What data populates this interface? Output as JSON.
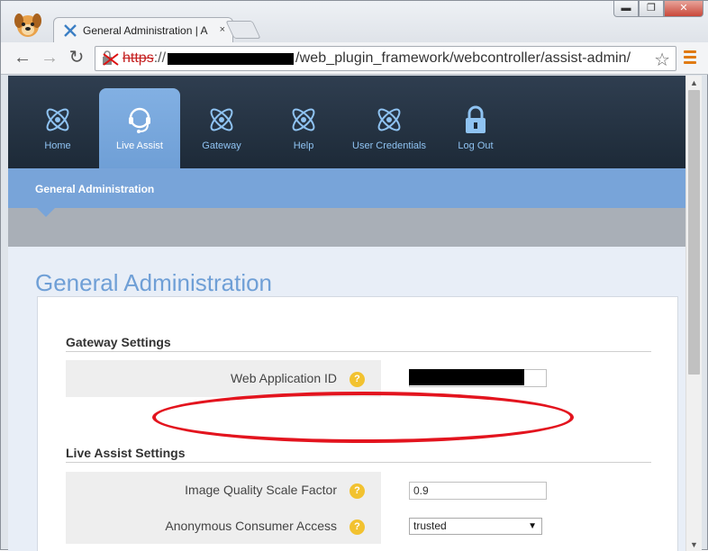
{
  "browser": {
    "tab_title": "General Administration | A",
    "tab_close": "×",
    "url_scheme": "https",
    "url_sep": "://",
    "url_path": "/web_plugin_framework/webcontroller/assist-admin/",
    "window_controls": {
      "minimize": "▬",
      "maximize": "❐",
      "close": "✕"
    },
    "nav": {
      "back": "←",
      "forward": "→",
      "reload": "↻"
    },
    "star": "☆"
  },
  "nav": {
    "items": [
      {
        "label": "Home",
        "icon": "atom-icon",
        "active": false
      },
      {
        "label": "Live Assist",
        "icon": "headset-icon",
        "active": true
      },
      {
        "label": "Gateway",
        "icon": "atom-icon",
        "active": false
      },
      {
        "label": "Help",
        "icon": "atom-icon",
        "active": false
      },
      {
        "label": "User Credentials",
        "icon": "atom-icon",
        "active": false
      },
      {
        "label": "Log Out",
        "icon": "lock-icon",
        "active": false
      }
    ]
  },
  "subnav": {
    "label": "General Administration"
  },
  "page": {
    "title": "General Administration"
  },
  "gateway": {
    "section_title": "Gateway Settings",
    "web_app_id_label": "Web Application ID"
  },
  "live_assist": {
    "section_title": "Live Assist Settings",
    "image_quality_label": "Image Quality Scale Factor",
    "image_quality_value": "0.9",
    "anon_access_label": "Anonymous Consumer Access",
    "anon_access_value": "trusted"
  },
  "help_glyph": "?",
  "colors": {
    "accent": "#6f9fd6",
    "nav_dark": "#1d2a38",
    "help": "#f2c230",
    "annotation": "#e3141e"
  }
}
